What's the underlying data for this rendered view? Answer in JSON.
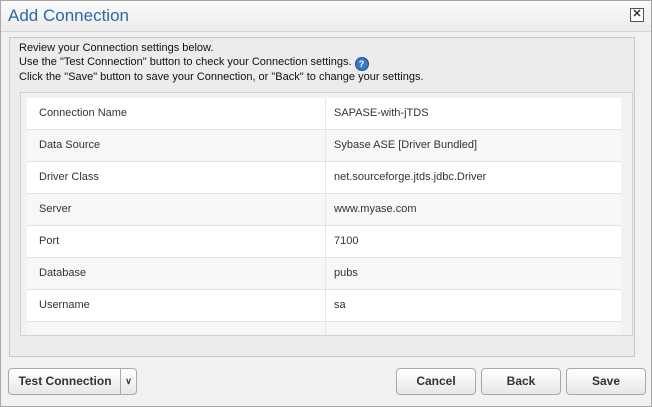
{
  "dialog": {
    "title": "Add Connection",
    "close_icon": "close-icon",
    "intro_line1": "Review your Connection settings below.",
    "intro_line2": "Use the \"Test Connection\" button to check your Connection settings.",
    "intro_line3": "Click the \"Save\" button to save your Connection, or \"Back\" to change your settings.",
    "help_icon": "?"
  },
  "settings": [
    {
      "label": "Connection Name",
      "value": "SAPASE-with-jTDS"
    },
    {
      "label": "Data Source",
      "value": "Sybase ASE [Driver Bundled]"
    },
    {
      "label": "Driver Class",
      "value": "net.sourceforge.jtds.jdbc.Driver"
    },
    {
      "label": "Server",
      "value": "www.myase.com"
    },
    {
      "label": "Port",
      "value": "7100"
    },
    {
      "label": "Database",
      "value": "pubs"
    },
    {
      "label": "Username",
      "value": "sa"
    }
  ],
  "buttons": {
    "test_connection": "Test Connection",
    "dropdown": "∨",
    "cancel": "Cancel",
    "back": "Back",
    "save": "Save"
  }
}
